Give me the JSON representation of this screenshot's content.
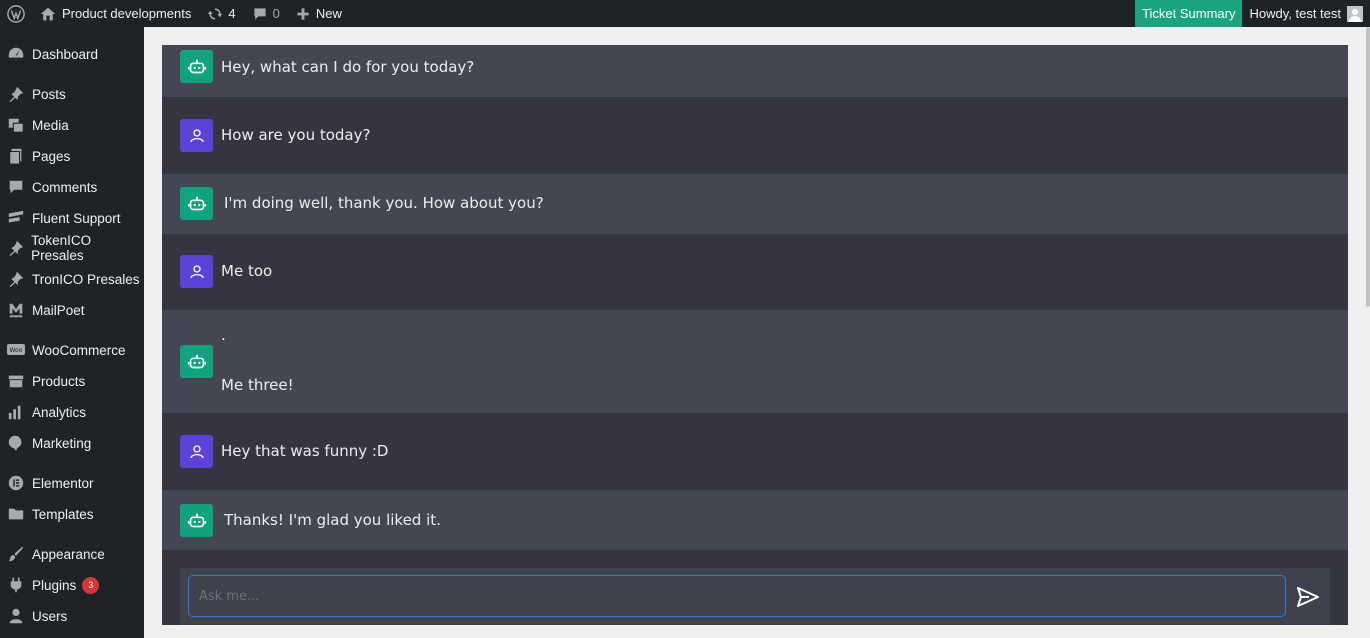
{
  "adminbar": {
    "site_name": "Product developments",
    "updates_count": "4",
    "comments_count": "0",
    "new_label": "New",
    "ticket_summary": "Ticket Summary",
    "howdy": "Howdy, test test"
  },
  "sidebar": {
    "items": [
      {
        "label": "Dashboard",
        "icon": "dashboard-icon"
      },
      {
        "label": "Posts",
        "icon": "pin-icon"
      },
      {
        "label": "Media",
        "icon": "media-icon"
      },
      {
        "label": "Pages",
        "icon": "pages-icon"
      },
      {
        "label": "Comments",
        "icon": "comment-icon"
      },
      {
        "label": "Fluent Support",
        "icon": "fluent-icon"
      },
      {
        "label": "TokenICO Presales",
        "icon": "pin-icon"
      },
      {
        "label": "TronICO Presales",
        "icon": "pin-icon"
      },
      {
        "label": "MailPoet",
        "icon": "mailpoet-icon"
      },
      {
        "label": "WooCommerce",
        "icon": "woo-icon"
      },
      {
        "label": "Products",
        "icon": "archive-icon"
      },
      {
        "label": "Analytics",
        "icon": "chart-icon"
      },
      {
        "label": "Marketing",
        "icon": "megaphone-icon"
      },
      {
        "label": "Elementor",
        "icon": "elementor-icon"
      },
      {
        "label": "Templates",
        "icon": "folder-icon"
      },
      {
        "label": "Appearance",
        "icon": "brush-icon"
      },
      {
        "label": "Plugins",
        "icon": "plugin-icon",
        "badge": "3"
      },
      {
        "label": "Users",
        "icon": "user-icon"
      }
    ]
  },
  "chat": {
    "messages": [
      {
        "role": "bot",
        "text": "Hey, what can I do for you today?"
      },
      {
        "role": "user",
        "text": "How are you today?"
      },
      {
        "role": "bot",
        "text": "I'm doing well, thank you. How about you?"
      },
      {
        "role": "user",
        "text": "Me too"
      },
      {
        "role": "bot",
        "text": ".",
        "text2": "Me three!"
      },
      {
        "role": "user",
        "text": "Hey that was funny :D"
      },
      {
        "role": "bot",
        "text": "Thanks! I'm glad you liked it."
      }
    ],
    "input_placeholder": "Ask me...",
    "input_value": ""
  },
  "colors": {
    "adminbar_bg": "#1d2327",
    "ticket_accent": "#19a37f",
    "bot_avatar": "#10a37f",
    "user_avatar": "#5a43d6",
    "chat_bg": "#343541",
    "bot_row_bg": "#444654"
  }
}
